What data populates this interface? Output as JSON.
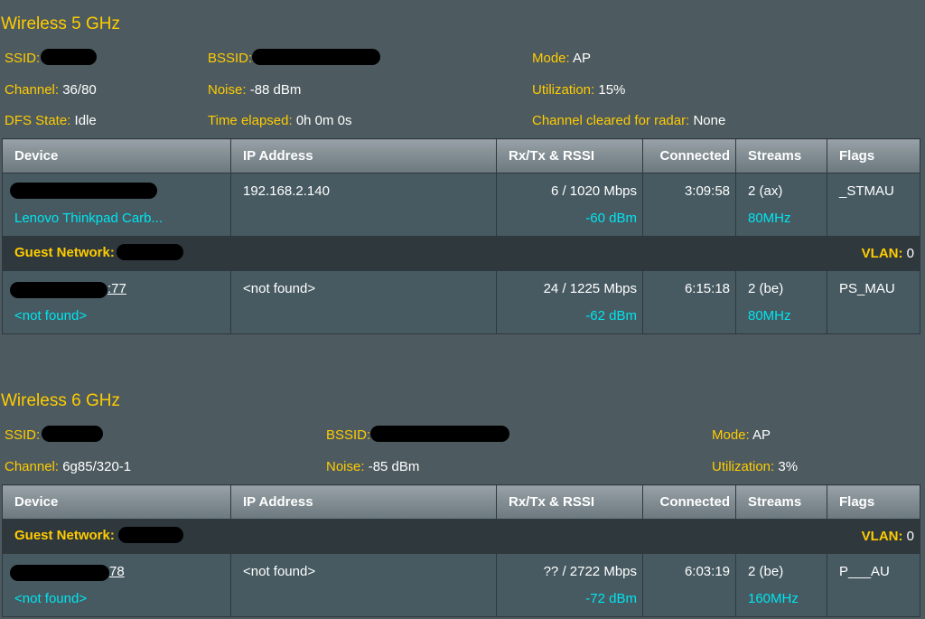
{
  "colors": {
    "background": "#4d5a60",
    "label": "#ffcc00",
    "value": "#ffffff",
    "accent_cyan": "#00e5f0",
    "row_bg": "#475a61",
    "guest_row_bg": "#2e383d"
  },
  "columns": [
    "Device",
    "IP Address",
    "Rx/Tx & RSSI",
    "Connected",
    "Streams",
    "Flags"
  ],
  "wireless5": {
    "title": "Wireless 5 GHz",
    "ssid_label": "SSID:",
    "ssid_value": "[redacted]",
    "bssid_label": "BSSID:",
    "bssid_value": "[redacted]",
    "mode_label": "Mode:",
    "mode_value": "AP",
    "channel_label": "Channel:",
    "channel_value": "36/80",
    "noise_label": "Noise:",
    "noise_value": "-88 dBm",
    "utilization_label": "Utilization:",
    "utilization_value": "15%",
    "dfs_label": "DFS State:",
    "dfs_value": "Idle",
    "elapsed_label": "Time elapsed:",
    "elapsed_value": "0h 0m 0s",
    "radar_label": "Channel cleared for radar:",
    "radar_value": "None",
    "clients": [
      {
        "device_name": "[redacted]",
        "device_desc": "Lenovo Thinkpad Carb...",
        "ip": "192.168.2.140",
        "rxtx": "6 / 1020 Mbps",
        "rssi": "-60 dBm",
        "connected": "3:09:58",
        "streams": "2 (ax)",
        "bandwidth": "80MHz",
        "flags": "_STMAU"
      }
    ],
    "guest": {
      "label": "Guest Network:",
      "name": "[redacted]",
      "vlan_label": "VLAN:",
      "vlan_value": "0",
      "clients": [
        {
          "device_name_suffix": ":77",
          "device_desc": "<not found>",
          "ip": "<not found>",
          "rxtx": "24 / 1225 Mbps",
          "rssi": "-62 dBm",
          "connected": "6:15:18",
          "streams": "2 (be)",
          "bandwidth": "80MHz",
          "flags": "PS_MAU"
        }
      ]
    }
  },
  "wireless6": {
    "title": "Wireless 6 GHz",
    "ssid_label": "SSID:",
    "ssid_value": "[redacted]",
    "bssid_label": "BSSID:",
    "bssid_value": "[redacted]",
    "mode_label": "Mode:",
    "mode_value": "AP",
    "channel_label": "Channel:",
    "channel_value": "6g85/320-1",
    "noise_label": "Noise:",
    "noise_value": "-85 dBm",
    "utilization_label": "Utilization:",
    "utilization_value": "3%",
    "guest": {
      "label": "Guest Network:",
      "name": "[redacted]",
      "vlan_label": "VLAN:",
      "vlan_value": "0",
      "clients": [
        {
          "device_name_suffix": "78",
          "device_desc": "<not found>",
          "ip": "<not found>",
          "rxtx": "?? / 2722 Mbps",
          "rssi": "-72 dBm",
          "connected": "6:03:19",
          "streams": "2 (be)",
          "bandwidth": "160MHz",
          "flags": "P___AU"
        }
      ]
    }
  }
}
